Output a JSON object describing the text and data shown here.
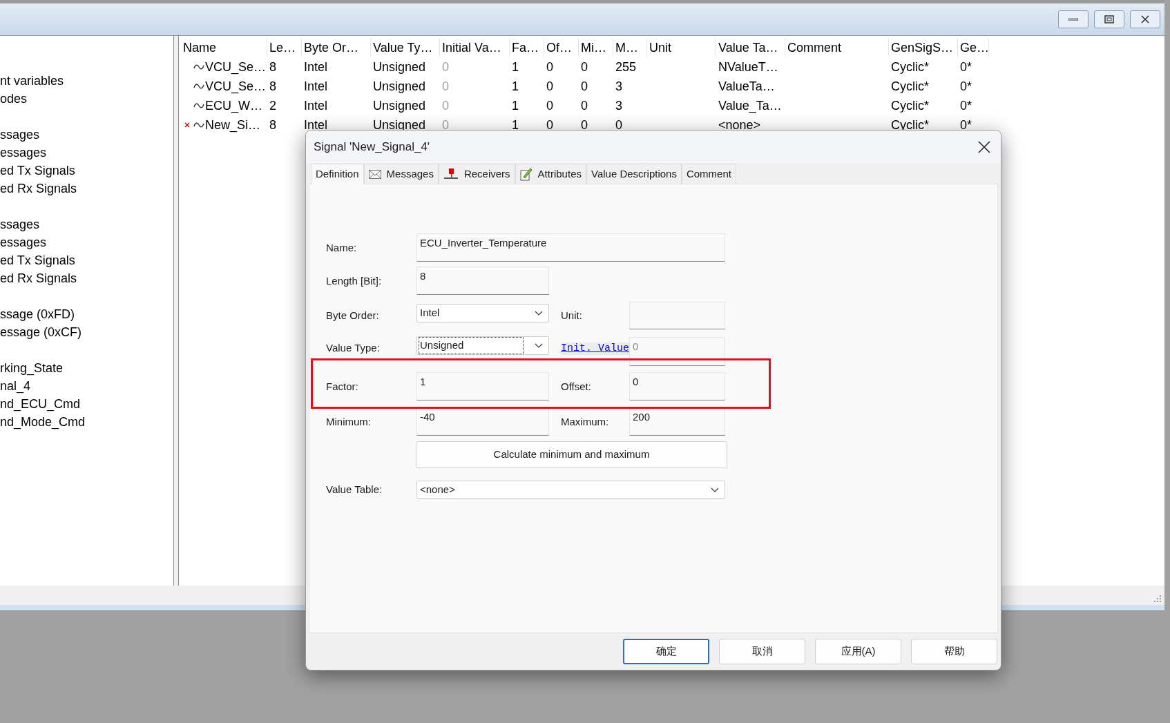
{
  "tree": {
    "groups": [
      [
        "nt variables",
        "odes"
      ],
      [
        "ssages",
        "essages",
        "ed Tx Signals",
        "ed Rx Signals"
      ],
      [
        "ssages",
        "essages",
        "ed Tx Signals",
        "ed Rx Signals"
      ],
      [
        "ssage (0xFD)",
        "essage (0xCF)"
      ],
      [
        "rking_State",
        "nal_4",
        "nd_ECU_Cmd",
        "nd_Mode_Cmd"
      ]
    ]
  },
  "table": {
    "columns": [
      "Name",
      "Le…",
      "Byte Or…",
      "Value Ty…",
      "Initial Va…",
      "Fa…",
      "Of…",
      "Mi…",
      "M…",
      "Unit",
      "Value Ta…",
      "Comment",
      "GenSigS…",
      "Ge…"
    ],
    "rows": [
      {
        "flagged": false,
        "cells": [
          "VCU_Se…",
          "8",
          "Intel",
          "Unsigned",
          {
            "text": "0",
            "dimmed": true
          },
          "1",
          "0",
          "0",
          "255",
          "",
          "NValueT…",
          "",
          "Cyclic*",
          "0*"
        ]
      },
      {
        "flagged": false,
        "cells": [
          "VCU_Se…",
          "8",
          "Intel",
          "Unsigned",
          {
            "text": "0",
            "dimmed": true
          },
          "1",
          "0",
          "0",
          "3",
          "",
          "ValueTa…",
          "",
          "Cyclic*",
          "0*"
        ]
      },
      {
        "flagged": false,
        "cells": [
          "ECU_W…",
          "2",
          "Intel",
          "Unsigned",
          {
            "text": "0",
            "dimmed": true
          },
          "1",
          "0",
          "0",
          "3",
          "",
          "Value_Ta…",
          "",
          "Cyclic*",
          "0*"
        ]
      },
      {
        "flagged": true,
        "cells": [
          "New_Si…",
          "8",
          "Intel",
          "Unsigned",
          {
            "text": "0",
            "dimmed": true
          },
          "1",
          "0",
          "0",
          "0",
          "",
          "<none>",
          "",
          "Cyclic*",
          "0*"
        ]
      }
    ]
  },
  "dialog": {
    "title": "Signal 'New_Signal_4'",
    "tabs": [
      {
        "label": "Definition",
        "selected": true
      },
      {
        "label": "Messages",
        "selected": false
      },
      {
        "label": "Receivers",
        "selected": false
      },
      {
        "label": "Attributes",
        "selected": false
      },
      {
        "label": "Value Descriptions",
        "selected": false
      },
      {
        "label": "Comment",
        "selected": false
      }
    ],
    "name": {
      "label": "Name:",
      "value": "ECU_Inverter_Temperature"
    },
    "length": {
      "label": "Length [Bit]:",
      "value": "8"
    },
    "byte_order": {
      "label": "Byte Order:",
      "value": "Intel",
      "focused": false
    },
    "unit": {
      "label": "Unit:"
    },
    "value_type": {
      "label": "Value Type:",
      "value": "Unsigned",
      "focused": true
    },
    "init_value": {
      "label": "Init. Value",
      "value": "0"
    },
    "factor": {
      "label": "Factor:",
      "value": "1"
    },
    "offset": {
      "label": "Offset:",
      "value": "0"
    },
    "minimum": {
      "label": "Minimum:",
      "value": "-40"
    },
    "maximum": {
      "label": "Maximum:",
      "value": "200"
    },
    "calculate_button": "Calculate minimum and maximum",
    "value_table": {
      "label": "Value Table:",
      "value": "<none>"
    },
    "buttons": [
      {
        "label": "确定",
        "default": true
      },
      {
        "label": "取消",
        "default": false
      },
      {
        "label": "应用(A)",
        "default": false
      },
      {
        "label": "帮助",
        "default": false
      }
    ]
  }
}
